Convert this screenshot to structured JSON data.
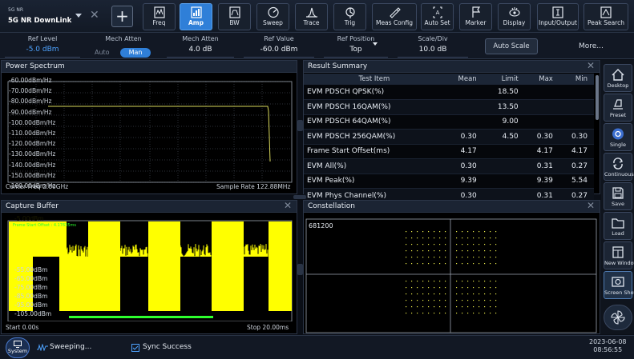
{
  "mode": {
    "line1": "5G NR",
    "line2": "5G NR DownLink"
  },
  "toolbar": [
    {
      "label": "Freq",
      "icon": "freq-icon"
    },
    {
      "label": "Amp",
      "icon": "amp-icon",
      "active": true
    },
    {
      "label": "BW",
      "icon": "bw-icon"
    },
    {
      "label": "Sweep",
      "icon": "sweep-icon"
    },
    {
      "label": "Trace",
      "icon": "trace-icon"
    },
    {
      "label": "Trig",
      "icon": "trig-icon"
    },
    {
      "label": "Meas Config",
      "icon": "meas-config-icon"
    },
    {
      "label": "Auto Set",
      "icon": "auto-set-icon"
    },
    {
      "label": "Marker",
      "icon": "marker-icon"
    },
    {
      "label": "Display",
      "icon": "display-icon"
    },
    {
      "label": "Input/Output",
      "icon": "input-output-icon"
    },
    {
      "label": "Peak Search",
      "icon": "peak-search-icon"
    }
  ],
  "params": {
    "ref_level": {
      "label": "Ref Level",
      "value": "-5.0 dBm"
    },
    "mech_atten_mode": {
      "label": "Mech Atten",
      "auto": "Auto",
      "man": "Man"
    },
    "mech_atten": {
      "label": "Mech Atten",
      "value": "4.0 dB"
    },
    "ref_value": {
      "label": "Ref Value",
      "value": "-60.0 dBm"
    },
    "ref_position": {
      "label": "Ref Position",
      "value": "Top"
    },
    "scale_div": {
      "label": "Scale/Div",
      "value": "10.0 dB"
    },
    "auto_scale": "Auto Scale",
    "more": "More..."
  },
  "power_spectrum": {
    "title": "Power Spectrum",
    "y_labels": [
      "-60.00dBm/Hz",
      "-70.00dBm/Hz",
      "-80.00dBm/Hz",
      "-90.00dBm/Hz",
      "-100.00dBm/Hz",
      "-110.00dBm/Hz",
      "-120.00dBm/Hz",
      "-130.00dBm/Hz",
      "-140.00dBm/Hz",
      "-150.00dBm/Hz",
      "-160.00dBm/Hz"
    ],
    "center_freq": "Center Freq 2.60GHz",
    "sample_rate": "Sample Rate 122.88MHz"
  },
  "result_summary": {
    "title": "Result Summary",
    "headers": [
      "Test Item",
      "Mean",
      "Limit",
      "Max",
      "Min"
    ],
    "rows": [
      [
        "EVM PDSCH QPSK(%)",
        "",
        "18.50",
        "",
        ""
      ],
      [
        "EVM PDSCH 16QAM(%)",
        "",
        "13.50",
        "",
        ""
      ],
      [
        "EVM PDSCH 64QAM(%)",
        "",
        "9.00",
        "",
        ""
      ],
      [
        "EVM PDSCH 256QAM(%)",
        "0.30",
        "4.50",
        "0.30",
        "0.30"
      ],
      [
        "Frame Start Offset(ms)",
        "4.17",
        "",
        "4.17",
        "4.17"
      ],
      [
        "EVM All(%)",
        "0.30",
        "",
        "0.31",
        "0.27"
      ],
      [
        "EVM Peak(%)",
        "9.39",
        "",
        "9.39",
        "5.54"
      ],
      [
        "EVM Phys Channel(%)",
        "0.30",
        "",
        "0.31",
        "0.27"
      ]
    ]
  },
  "capture_buffer": {
    "title": "Capture Buffer",
    "marker": "Frame Start Offset : 4.17635ms",
    "y_labels": [
      "-5.00dBm",
      "-55.00dBm",
      "-65.00dBm",
      "-75.00dBm",
      "-85.00dBm",
      "-95.00dBm",
      "-105.00dBm"
    ],
    "start": "Start 0.00s",
    "stop": "Stop 20.00ms"
  },
  "constellation": {
    "title": "Constellation",
    "count": "681200"
  },
  "sidebar": [
    {
      "label": "Desktop",
      "icon": "desktop-icon"
    },
    {
      "label": "Preset",
      "icon": "preset-icon"
    },
    {
      "label": "Single",
      "icon": "single-icon"
    },
    {
      "label": "Continuous",
      "icon": "continuous-icon"
    },
    {
      "label": "Save",
      "icon": "save-icon"
    },
    {
      "label": "Load",
      "icon": "load-icon"
    },
    {
      "label": "New Window",
      "icon": "new-window-icon"
    },
    {
      "label": "Screen Shot",
      "icon": "screen-shot-icon",
      "active": true
    }
  ],
  "status": {
    "system": "System",
    "sweeping": "Sweeping...",
    "sync": "Sync Success",
    "date": "2023-06-08",
    "time": "08:56:55"
  },
  "colors": {
    "accent": "#2f7fd8",
    "trace_yellow": "#ffff00",
    "trace_green": "#2dff2d",
    "spectrum_trace": "#d8d85a"
  }
}
